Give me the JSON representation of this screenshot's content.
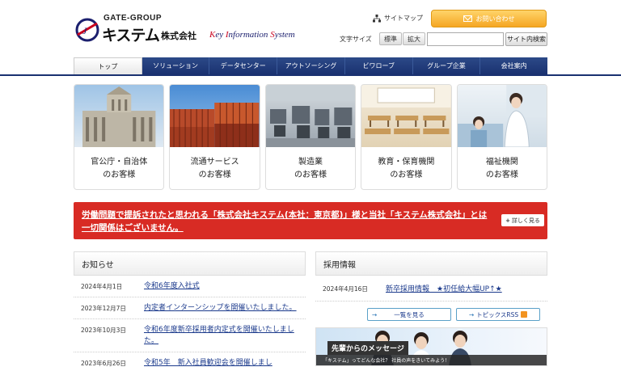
{
  "header": {
    "logo_group": "GATE-GROUP",
    "logo_company": "キステム",
    "logo_kaisha": "株式会社",
    "logo_tagline_k": "K",
    "logo_tagline_ey": "ey ",
    "logo_tagline_i": "I",
    "logo_tagline_nformation": "nformation ",
    "logo_tagline_s": "S",
    "logo_tagline_ystem": "ystem",
    "sitemap": "サイトマップ",
    "contact": "お問い合わせ",
    "font_size_label": "文字サイズ",
    "font_standard": "標準",
    "font_large": "拡大",
    "search_value": "",
    "search_button": "サイト内検索"
  },
  "nav": [
    "トップ",
    "ソリューション",
    "データセンター",
    "アウトソーシング",
    "ビワローブ",
    "グループ企業",
    "会社案内"
  ],
  "tiles": [
    {
      "line1": "官公庁・自治体",
      "line2": "のお客様"
    },
    {
      "line1": "流通サービス",
      "line2": "のお客様"
    },
    {
      "line1": "製造業",
      "line2": "のお客様"
    },
    {
      "line1": "教育・保育機関",
      "line2": "のお客様"
    },
    {
      "line1": "福祉機関",
      "line2": "のお客様"
    }
  ],
  "notice": {
    "text": "労働問題で提訴されたと思われる「株式会社キステム(本社：東京都)」様と当社「キステム株式会社」とは一切関係はございません。",
    "detail": "詳しく見る"
  },
  "news": {
    "heading": "お知らせ",
    "items": [
      {
        "date": "2024年4月1日",
        "title": "令和6年度入社式"
      },
      {
        "date": "2023年12月7日",
        "title": "内定者インターンシップを開催いたしました。"
      },
      {
        "date": "2023年10月3日",
        "title": "令和6年度新卒採用者内定式を開催いたしました。"
      },
      {
        "date": "2023年6月26日",
        "title": "令和5年　新入社員歓迎会を開催しまし"
      }
    ]
  },
  "recruit": {
    "heading": "採用情報",
    "items": [
      {
        "date": "2024年4月16日",
        "title": "新卒採用情報　★初任給大幅UP↑★"
      }
    ],
    "list_button": "一覧を見る",
    "rss_button": "トピックスRSS",
    "banner_title": "先輩からのメッセージ",
    "banner_sub": "「キステム」ってどんな会社？ 社員の声をきいてみよう！"
  },
  "colors": {
    "nav": "#1a3170",
    "notice": "#d82b24",
    "contact": "#f5a623"
  }
}
